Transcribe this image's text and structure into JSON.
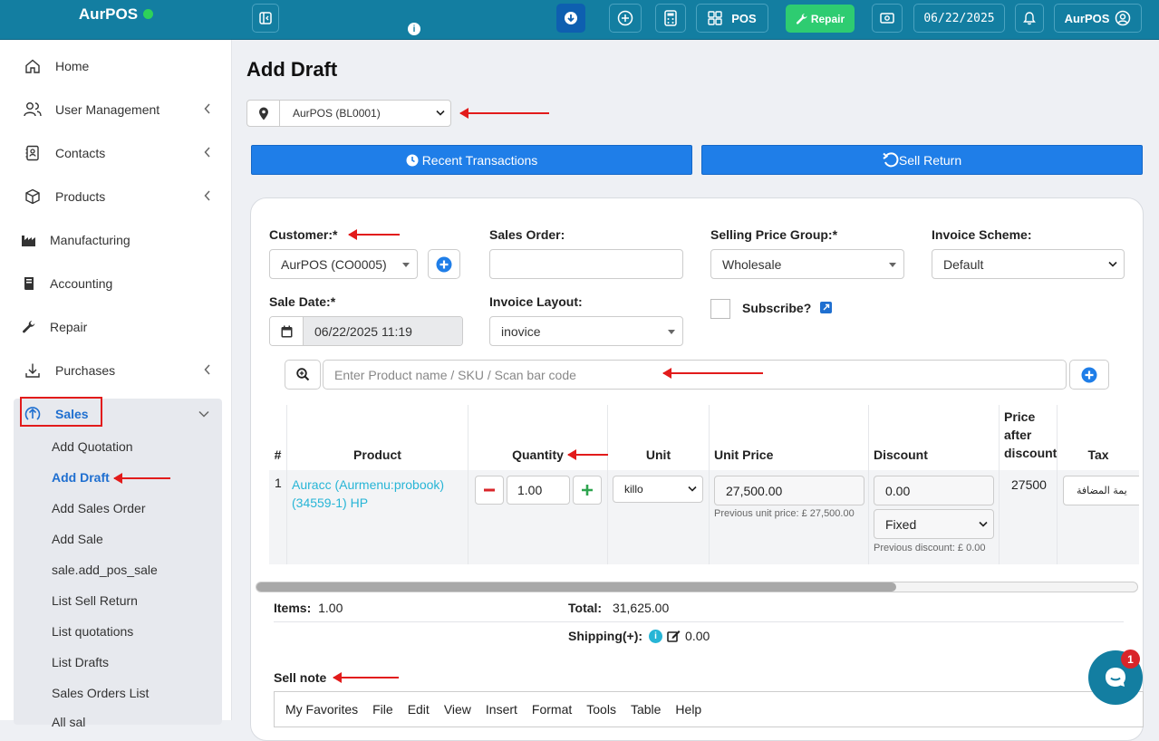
{
  "brand": {
    "name": "AurPOS",
    "status_color": "#2ed15a"
  },
  "topbar": {
    "pos_label": "POS",
    "repair_label": "Repair",
    "date": "06/22/2025",
    "user": "AurPOS"
  },
  "sidebar": {
    "items": [
      {
        "label": "Home",
        "icon": "home-icon"
      },
      {
        "label": "User Management",
        "icon": "users-icon"
      },
      {
        "label": "Contacts",
        "icon": "contacts-icon"
      },
      {
        "label": "Products",
        "icon": "cube-icon"
      },
      {
        "label": "Manufacturing",
        "icon": "factory-icon"
      },
      {
        "label": "Accounting",
        "icon": "book-icon"
      },
      {
        "label": "Repair",
        "icon": "wrench-icon"
      },
      {
        "label": "Purchases",
        "icon": "download-icon"
      },
      {
        "label": "Sales",
        "icon": "upload-icon"
      }
    ],
    "sales_sub": [
      "Add Quotation",
      "Add Draft",
      "Add Sales Order",
      "Add Sale",
      "sale.add_pos_sale",
      "List Sell Return",
      "List quotations",
      "List Drafts",
      "Sales Orders List",
      "All sal"
    ]
  },
  "page": {
    "title": "Add Draft",
    "location": "AurPOS (BL0001)",
    "recent_btn": "Recent Transactions",
    "return_btn": "Sell Return"
  },
  "form": {
    "customer_label": "Customer:*",
    "customer_value": "AurPOS (CO0005)",
    "sales_order_label": "Sales Order:",
    "price_group_label": "Selling Price Group:*",
    "price_group_value": "Wholesale",
    "invoice_scheme_label": "Invoice Scheme:",
    "invoice_scheme_value": "Default",
    "sale_date_label": "Sale Date:*",
    "sale_date_value": "06/22/2025 11:19",
    "invoice_layout_label": "Invoice Layout:",
    "invoice_layout_value": "inovice",
    "subscribe_label": "Subscribe?",
    "search_placeholder": "Enter Product name / SKU / Scan bar code"
  },
  "table": {
    "headers": [
      "#",
      "Product",
      "Quantity",
      "Unit",
      "Unit Price",
      "Discount",
      "Price after discount",
      "Tax"
    ],
    "row": {
      "num": "1",
      "product": "Auracc (Aurmenu:probook) (34559-1) HP",
      "qty": "1.00",
      "unit": "killo",
      "unit_price": "27,500.00",
      "prev_unit_price": "Previous unit price: £ 27,500.00",
      "discount": "0.00",
      "discount_type": "Fixed",
      "prev_discount": "Previous discount: £ 0.00",
      "price_after": "27500",
      "tax": "يمة المضافة"
    }
  },
  "totals": {
    "items_label": "Items:",
    "items_value": "1.00",
    "total_label": "Total:",
    "total_value": "31,625.00",
    "shipping_label": "Shipping(+):",
    "shipping_value": "0.00"
  },
  "notes": {
    "label": "Sell note",
    "menu": [
      "My Favorites",
      "File",
      "Edit",
      "View",
      "Insert",
      "Format",
      "Tools",
      "Table",
      "Help"
    ]
  },
  "chat": {
    "badge": "1"
  },
  "colors": {
    "topbar": "#137ea1",
    "primary": "#1f7ee8",
    "repair": "#2ecc71",
    "annotation": "#e21b1b"
  }
}
